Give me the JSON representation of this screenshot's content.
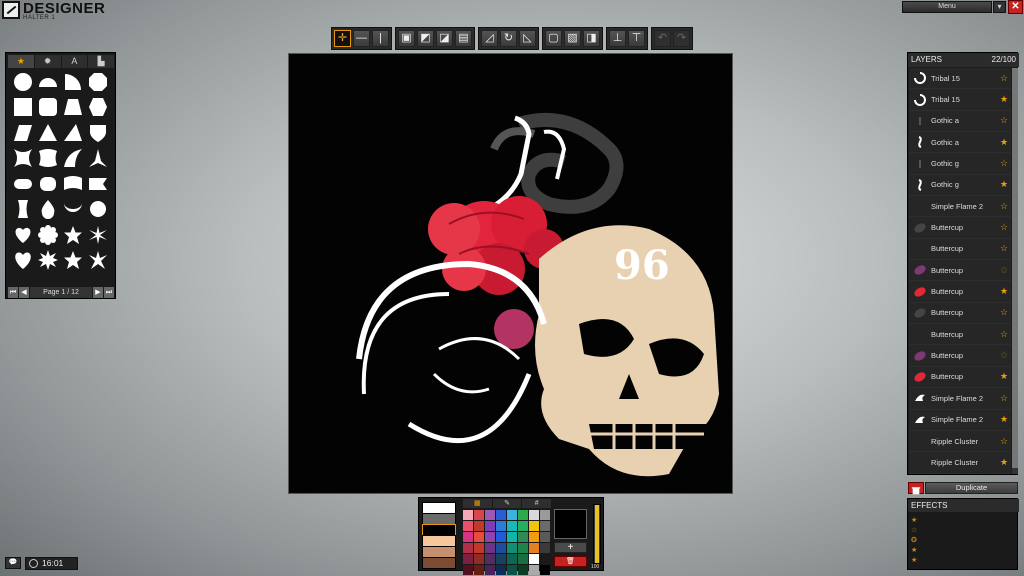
{
  "app": {
    "title": "DESIGNER",
    "subtitle": "HALTER 1"
  },
  "header": {
    "menu_label": "Menu",
    "menu_arrow": "▾",
    "close_label": "✕"
  },
  "toolbar": {
    "groups": [
      [
        "move-tool",
        "horizontal-align",
        "vertical-align"
      ],
      [
        "arrange-front",
        "arrange-back",
        "arrange-forward",
        "arrange-backward"
      ],
      [
        "skew",
        "rotate",
        "scale"
      ],
      [
        "layer-1",
        "layer-2",
        "layer-3"
      ],
      [
        "flip-horizontal",
        "flip-vertical"
      ],
      [
        "undo",
        "redo"
      ]
    ]
  },
  "shapes": {
    "tabs": [
      {
        "name": "shapes-star-tab",
        "label": "★"
      },
      {
        "name": "shapes-burst-tab",
        "label": "✹"
      },
      {
        "name": "shapes-text-tab",
        "label": "A"
      },
      {
        "name": "shapes-import-tab",
        "label": "▙"
      }
    ],
    "page_label": "Page 1 / 12"
  },
  "layers": {
    "title": "LAYERS",
    "count": "22/100",
    "items": [
      {
        "name": "Tribal 15",
        "thumb": "swirl",
        "starred": "outline"
      },
      {
        "name": "Tribal 15",
        "thumb": "swirl",
        "starred": "filled"
      },
      {
        "name": "Gothic a",
        "thumb": "gothic-dark",
        "starred": "outline"
      },
      {
        "name": "Gothic a",
        "thumb": "gothic-light",
        "starred": "filled"
      },
      {
        "name": "Gothic g",
        "thumb": "gothic-dark",
        "starred": "outline"
      },
      {
        "name": "Gothic g",
        "thumb": "gothic-light",
        "starred": "filled"
      },
      {
        "name": "Simple Flame 2",
        "thumb": "none",
        "starred": "outline"
      },
      {
        "name": "Buttercup",
        "thumb": "flower-dark",
        "starred": "outline"
      },
      {
        "name": "Buttercup",
        "thumb": "none",
        "starred": "outline"
      },
      {
        "name": "Buttercup",
        "thumb": "flower-purple",
        "starred": "dim"
      },
      {
        "name": "Buttercup",
        "thumb": "flower-red",
        "starred": "filled"
      },
      {
        "name": "Buttercup",
        "thumb": "flower-dark",
        "starred": "outline"
      },
      {
        "name": "Buttercup",
        "thumb": "none",
        "starred": "outline"
      },
      {
        "name": "Buttercup",
        "thumb": "flower-purple",
        "starred": "dim"
      },
      {
        "name": "Buttercup",
        "thumb": "flower-red",
        "starred": "filled"
      },
      {
        "name": "Simple Flame 2",
        "thumb": "flame",
        "starred": "outline"
      },
      {
        "name": "Simple Flame 2",
        "thumb": "flame",
        "starred": "filled"
      },
      {
        "name": "Ripple Cluster",
        "thumb": "none",
        "starred": "outline"
      },
      {
        "name": "Ripple Cluster",
        "thumb": "none",
        "starred": "filled"
      }
    ],
    "delete_label": "",
    "duplicate_label": "Duplicate"
  },
  "effects": {
    "title": "EFFECTS"
  },
  "colors": {
    "tabs": [
      "▦",
      "✎",
      "#"
    ],
    "recent": [
      "#ffffff",
      "#6b6b6b",
      "#000000",
      "#f5c79a",
      "#c49070",
      "#7b4b33"
    ],
    "palette": [
      "#f7a8b8",
      "#d8454f",
      "#9b59b6",
      "#2b5bd6",
      "#3bb3e0",
      "#2eaa4a",
      "#d9d9d9",
      "#9a9a9a",
      "#e8506b",
      "#c0392b",
      "#7d3cb5",
      "#2b7cd6",
      "#18b8b8",
      "#27ae60",
      "#f1c40f",
      "#6b6b6b",
      "#d63384",
      "#e74c3c",
      "#8e44ad",
      "#1f5cd6",
      "#0fb5a6",
      "#2e8b57",
      "#f39c12",
      "#5a5a5a",
      "#b0304a",
      "#c0392b",
      "#6c3483",
      "#1b4f9c",
      "#138d75",
      "#1e8449",
      "#e67e22",
      "#3a3a3a",
      "#802040",
      "#922b21",
      "#512e5f",
      "#154360",
      "#0e6655",
      "#196f3d",
      "#ffffff",
      "#1a1a1a",
      "#501020",
      "#641e16",
      "#4a235a",
      "#0b2e55",
      "#0b5345",
      "#0e3b22",
      "#aaaaaa",
      "#000000"
    ],
    "add_label": "+",
    "remove_label": "🗑",
    "opacity": 100
  },
  "status": {
    "time": "16:01"
  }
}
